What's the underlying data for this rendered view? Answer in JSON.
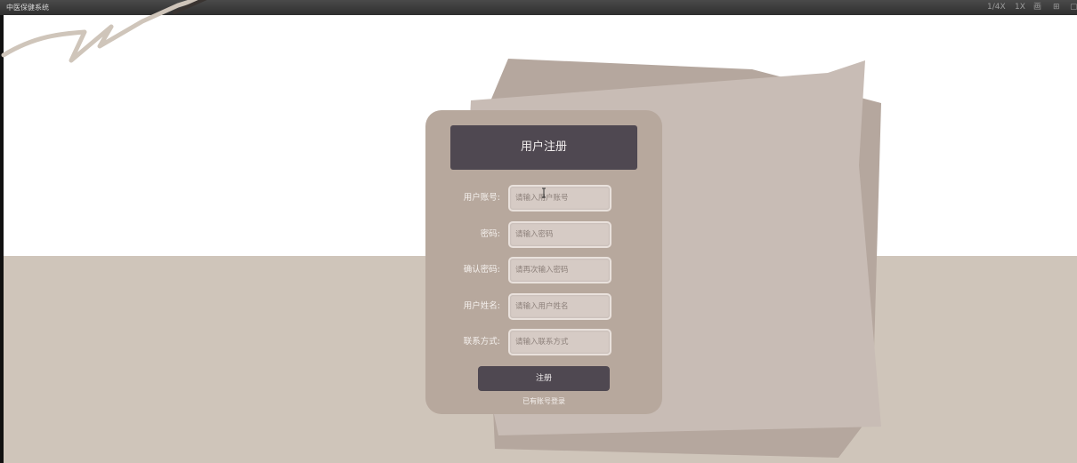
{
  "window": {
    "title": "中医保健系统",
    "controls": [
      "1/4X",
      "1X",
      "画",
      "⊞",
      "▢"
    ]
  },
  "colors": {
    "card": "#b7a89d",
    "header": "#4f4851",
    "floor": "#cfc5ba",
    "paper": "#c8bcb5",
    "paper_dark": "#b5a79e"
  },
  "form": {
    "title": "用户注册",
    "fields": [
      {
        "label": "用户账号:",
        "placeholder": "请输入用户账号",
        "value": ""
      },
      {
        "label": "密码:",
        "placeholder": "请输入密码",
        "value": ""
      },
      {
        "label": "确认密码:",
        "placeholder": "请再次输入密码",
        "value": ""
      },
      {
        "label": "用户姓名:",
        "placeholder": "请输入用户姓名",
        "value": ""
      },
      {
        "label": "联系方式:",
        "placeholder": "请输入联系方式",
        "value": ""
      }
    ],
    "submit_label": "注册",
    "login_link": "已有账号登录"
  }
}
